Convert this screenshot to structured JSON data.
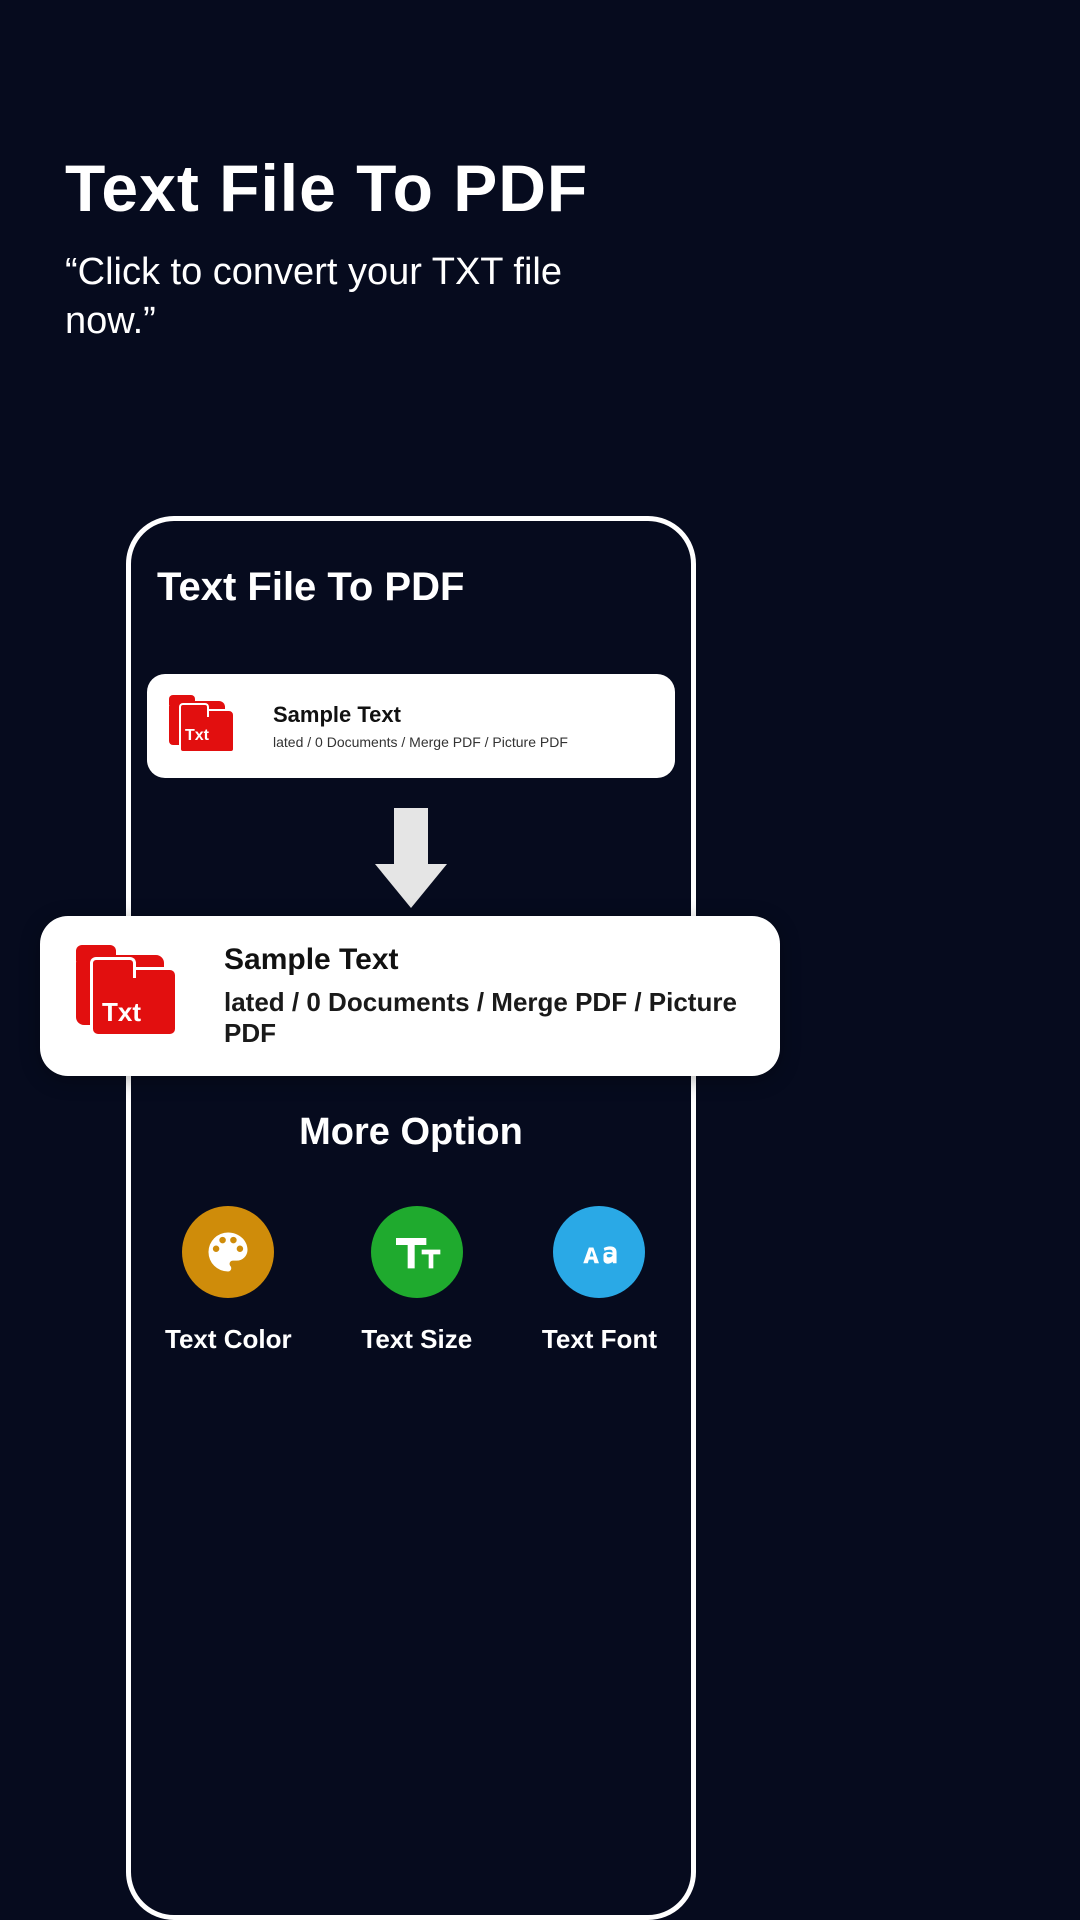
{
  "header": {
    "title": "Text File To PDF",
    "subtitle": "“Click to convert your TXT file now.”"
  },
  "panel": {
    "title": "Text File To PDF",
    "source": {
      "icon_label": "Txt",
      "title": "Sample Text",
      "subtitle": "lated / 0 Documents / Merge PDF / Picture PDF"
    },
    "target": {
      "icon_label": "Txt",
      "title": "Sample Text",
      "subtitle": "lated / 0 Documents / Merge PDF / Picture PDF"
    },
    "more": {
      "title": "More Option",
      "options": [
        {
          "label": "Text Color",
          "color": "#cf8c0a"
        },
        {
          "label": "Text Size",
          "color": "#1faa2e"
        },
        {
          "label": "Text Font",
          "color": "#2aa9e6"
        }
      ]
    }
  }
}
